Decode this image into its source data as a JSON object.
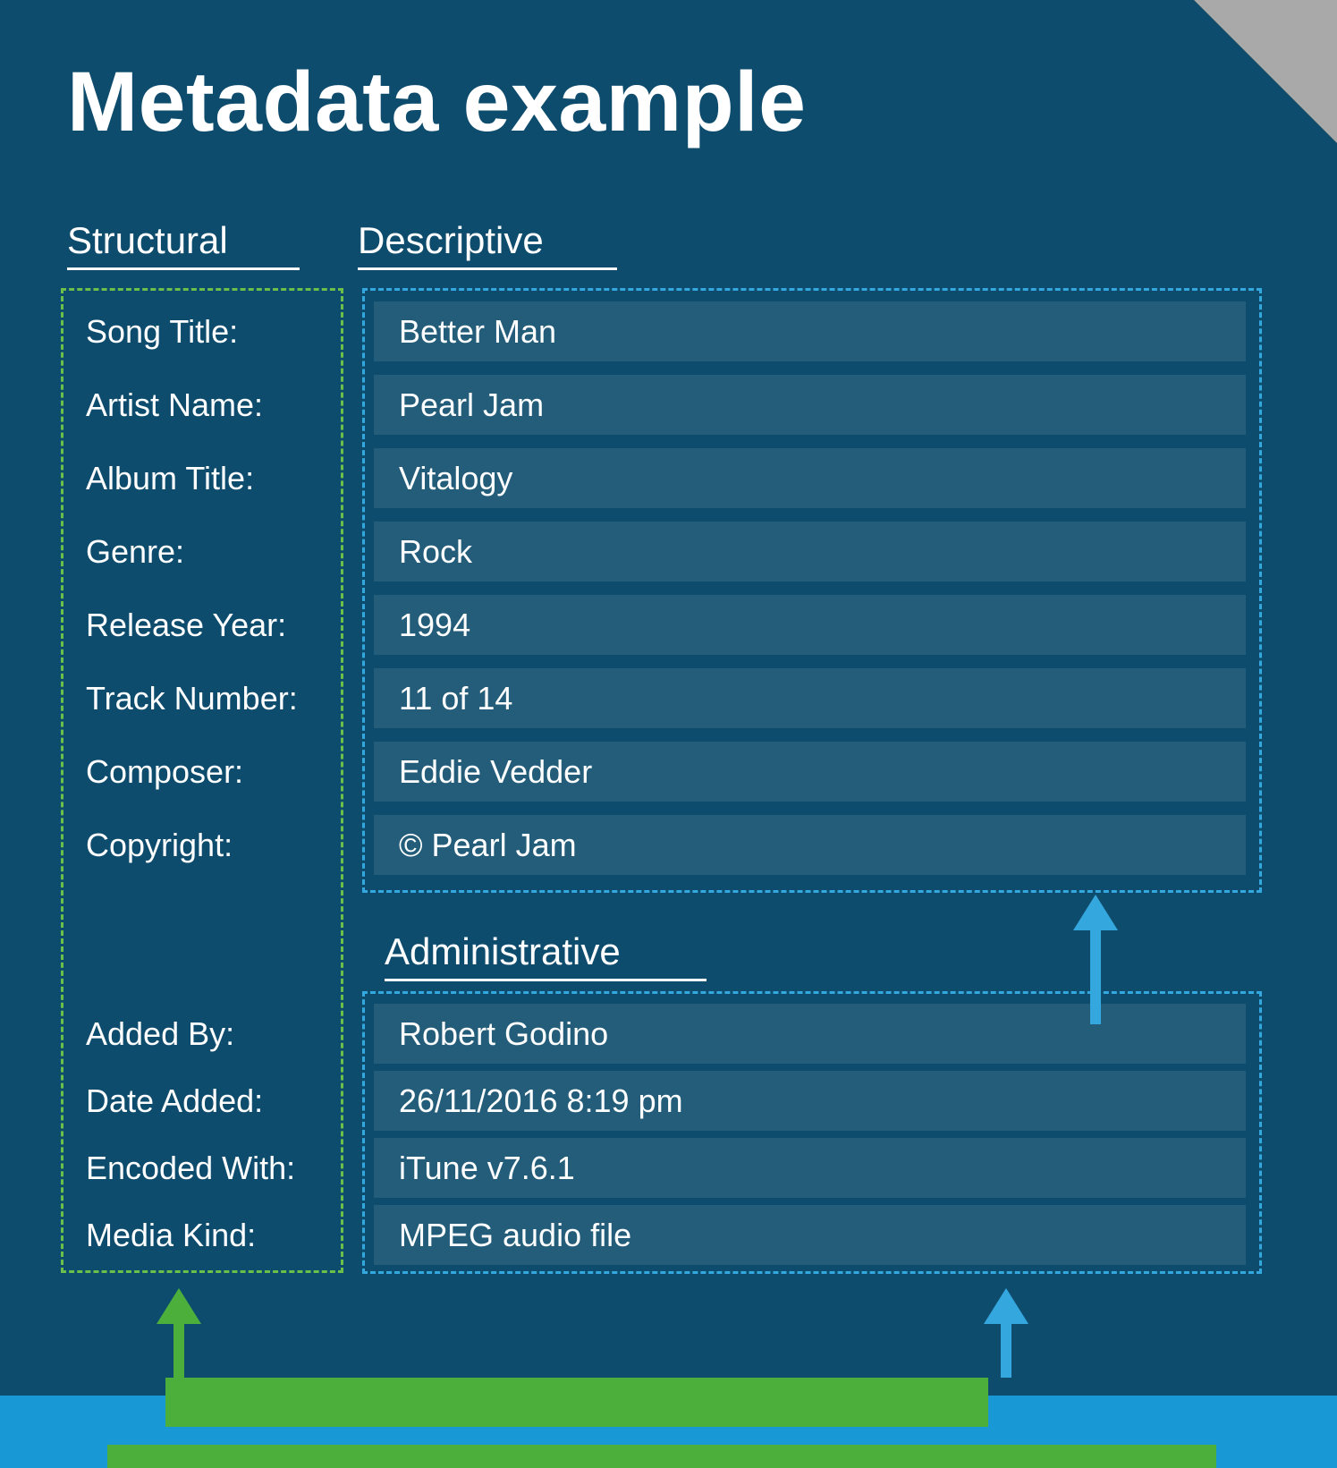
{
  "title": "Metadata example",
  "headers": {
    "structural": "Structural",
    "descriptive": "Descriptive",
    "administrative": "Administrative"
  },
  "structural_labels": [
    "Song Title:",
    "Artist Name:",
    "Album Title:",
    "Genre:",
    "Release Year:",
    "Track Number:",
    "Composer:",
    "Copyright:"
  ],
  "admin_structural_labels": [
    "Added By:",
    "Date Added:",
    "Encoded With:",
    "Media Kind:"
  ],
  "descriptive_values": [
    "Better Man",
    "Pearl Jam",
    "Vitalogy",
    "Rock",
    "1994",
    "11 of 14",
    "Eddie Vedder",
    "© Pearl Jam"
  ],
  "administrative_values": [
    "Robert Godino",
    "26/11/2016  8:19 pm",
    "iTune v7.6.1",
    "MPEG audio file"
  ],
  "colors": {
    "panel": "#0e4c6e",
    "green": "#6cc04a",
    "green_solid": "#4caf3c",
    "blue": "#35a7df",
    "cell": "#235d7a"
  }
}
